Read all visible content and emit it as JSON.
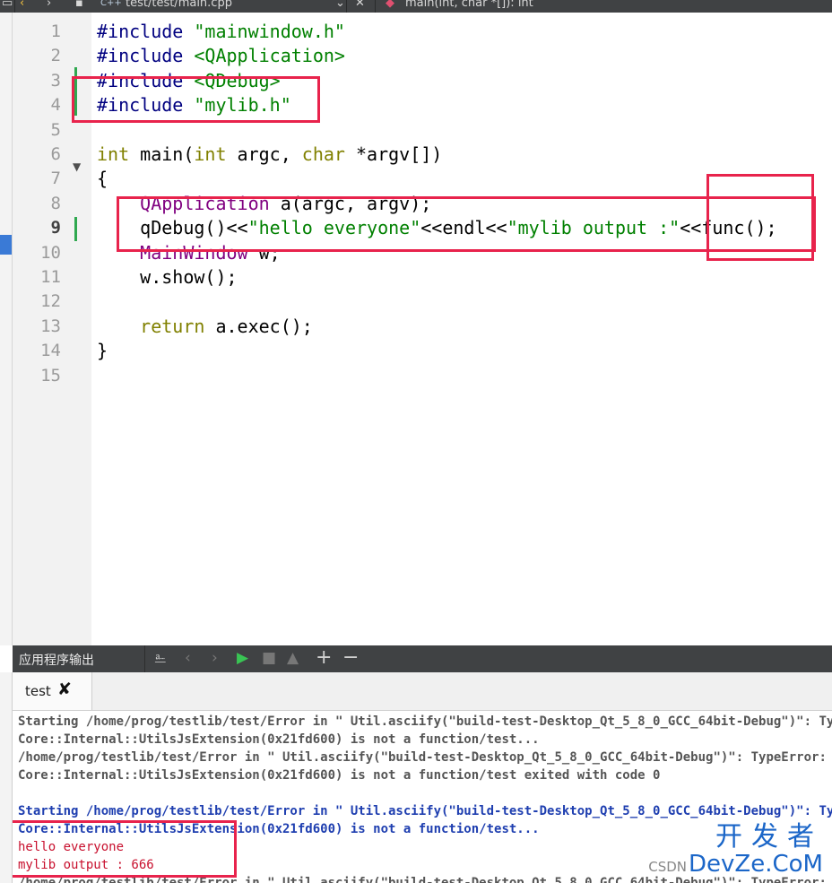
{
  "toolbar": {
    "file_path": "test/test/main.cpp",
    "file_icon_label": "C++",
    "close_glyph": "✕",
    "function_symbol": "main(int, char *[]): int"
  },
  "editor": {
    "line_numbers": [
      "1",
      "2",
      "3",
      "4",
      "5",
      "6",
      "7",
      "8",
      "9",
      "10",
      "11",
      "12",
      "13",
      "14",
      "15"
    ],
    "current_line": "9",
    "lines": [
      {
        "parts": [
          {
            "t": "#include ",
            "c": "pp"
          },
          {
            "t": "\"mainwindow.h\"",
            "c": "str"
          }
        ]
      },
      {
        "parts": [
          {
            "t": "#include ",
            "c": "pp"
          },
          {
            "t": "<QApplication>",
            "c": "str"
          }
        ]
      },
      {
        "parts": [
          {
            "t": "#include ",
            "c": "pp"
          },
          {
            "t": "<QDebug>",
            "c": "str"
          }
        ]
      },
      {
        "parts": [
          {
            "t": "#include ",
            "c": "pp"
          },
          {
            "t": "\"mylib.h\"",
            "c": "str"
          }
        ]
      },
      {
        "parts": []
      },
      {
        "parts": [
          {
            "t": "int",
            "c": "kw"
          },
          {
            "t": " main(",
            "c": ""
          },
          {
            "t": "int",
            "c": "kw"
          },
          {
            "t": " argc, ",
            "c": ""
          },
          {
            "t": "char",
            "c": "kw"
          },
          {
            "t": " *argv[])",
            "c": ""
          }
        ]
      },
      {
        "parts": [
          {
            "t": "{",
            "c": ""
          }
        ]
      },
      {
        "parts": [
          {
            "t": "    ",
            "c": ""
          },
          {
            "t": "QApplication",
            "c": "cls"
          },
          {
            "t": " a(argc, argv);",
            "c": ""
          }
        ]
      },
      {
        "parts": [
          {
            "t": "    qDebug()<<",
            "c": ""
          },
          {
            "t": "\"hello everyone\"",
            "c": "str"
          },
          {
            "t": "<<endl<<",
            "c": ""
          },
          {
            "t": "\"mylib output :\"",
            "c": "str"
          },
          {
            "t": "<<func();",
            "c": ""
          }
        ]
      },
      {
        "parts": [
          {
            "t": "    ",
            "c": ""
          },
          {
            "t": "MainWindow",
            "c": "cls"
          },
          {
            "t": " w;",
            "c": ""
          }
        ]
      },
      {
        "parts": [
          {
            "t": "    w.show();",
            "c": ""
          }
        ]
      },
      {
        "parts": []
      },
      {
        "parts": [
          {
            "t": "    ",
            "c": ""
          },
          {
            "t": "return",
            "c": "kw"
          },
          {
            "t": " a.exec();",
            "c": ""
          }
        ]
      },
      {
        "parts": [
          {
            "t": "}",
            "c": ""
          }
        ]
      },
      {
        "parts": []
      }
    ]
  },
  "output_pane": {
    "title": "应用程序输出",
    "tab_label": "test",
    "tab_close": "✘",
    "lines": [
      {
        "text": "Starting /home/prog/testlib/test/Error in \" Util.asciify(\"build-test-Desktop_Qt_5_8_0_GCC_64bit-Debug\")\": TypeError: Property 'asciify' of object",
        "style": "gray"
      },
      {
        "text": "Core::Internal::UtilsJsExtension(0x21fd600) is not a function/test...",
        "style": "gray"
      },
      {
        "text": "/home/prog/testlib/test/Error in \" Util.asciify(\"build-test-Desktop_Qt_5_8_0_GCC_64bit-Debug\")\": TypeError: Property 'asciify' of object",
        "style": "gray"
      },
      {
        "text": "Core::Internal::UtilsJsExtension(0x21fd600) is not a function/test exited with code 0",
        "style": "gray"
      },
      {
        "text": "",
        "style": "gray"
      },
      {
        "text": "Starting /home/prog/testlib/test/Error in \" Util.asciify(\"build-test-Desktop_Qt_5_8_0_GCC_64bit-Debug\")\": TypeError: Property 'asciify' of object",
        "style": "blue"
      },
      {
        "text": "Core::Internal::UtilsJsExtension(0x21fd600) is not a function/test...",
        "style": "blue"
      },
      {
        "text": "hello everyone",
        "style": "red"
      },
      {
        "text": "mylib output : 666",
        "style": "red"
      },
      {
        "text": "/home/prog/testlib/test/Error in \" Util.asciify(\"build-test-Desktop_Qt_5_8_0_GCC_64bit-Debug\")\": TypeError: Property 'asciify' of object",
        "style": "gray"
      }
    ]
  },
  "watermark": {
    "cn": "开发者",
    "prefix": "CSDN",
    "en": "DevZe.CoM"
  },
  "colors": {
    "highlight_box": "#e8234c",
    "preprocessor": "#000080",
    "string": "#008000",
    "keyword": "#808000",
    "class": "#800080"
  }
}
